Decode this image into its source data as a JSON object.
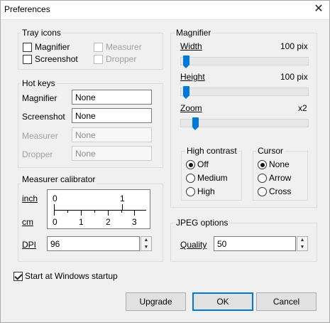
{
  "window": {
    "title": "Preferences",
    "close_glyph": "✕"
  },
  "tray_icons": {
    "legend": "Tray icons",
    "items": [
      {
        "label": "Magnifier",
        "checked": false,
        "enabled": true
      },
      {
        "label": "Screenshot",
        "checked": false,
        "enabled": true
      },
      {
        "label": "Measurer",
        "checked": false,
        "enabled": false
      },
      {
        "label": "Dropper",
        "checked": false,
        "enabled": false
      }
    ]
  },
  "hot_keys": {
    "legend": "Hot keys",
    "rows": [
      {
        "label": "Magnifier",
        "value": "None",
        "enabled": true
      },
      {
        "label": "Screenshot",
        "value": "None",
        "enabled": true
      },
      {
        "label": "Measurer",
        "value": "None",
        "enabled": false
      },
      {
        "label": "Dropper",
        "value": "None",
        "enabled": false
      }
    ]
  },
  "measurer_calibrator": {
    "legend": "Measurer calibrator",
    "inch_label": "inch",
    "cm_label": "cm",
    "inch_ticks": [
      "0",
      "1"
    ],
    "cm_ticks": [
      "0",
      "1",
      "2",
      "3"
    ],
    "dpi_label": "DPI",
    "dpi_value": "96"
  },
  "magnifier": {
    "legend": "Magnifier",
    "width_label": "Width",
    "width_value": "100 pix",
    "width_level": 0.0,
    "height_label": "Height",
    "height_value": "100 pix",
    "height_level": 0.0,
    "zoom_label": "Zoom",
    "zoom_value": "x2",
    "zoom_level": 0.1,
    "high_contrast": {
      "legend": "High contrast",
      "options": [
        "Off",
        "Medium",
        "High"
      ],
      "selected": "Off"
    },
    "cursor": {
      "legend": "Cursor",
      "options": [
        "None",
        "Arrow",
        "Cross"
      ],
      "selected": "None"
    }
  },
  "jpeg": {
    "legend": "JPEG options",
    "quality_label": "Quality",
    "quality_value": "50"
  },
  "startup": {
    "label": "Start at Windows startup",
    "checked": true
  },
  "buttons": {
    "upgrade": "Upgrade",
    "ok": "OK",
    "cancel": "Cancel"
  },
  "spin_glyphs": {
    "up": "▲",
    "down": "▼"
  },
  "colors": {
    "accent": "#0078d7",
    "background": "#f0f0f0"
  }
}
